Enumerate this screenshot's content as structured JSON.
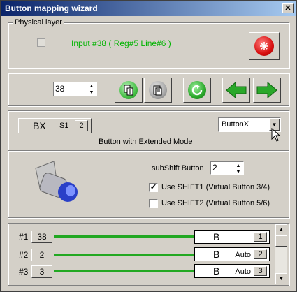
{
  "window": {
    "title": "Button mapping wizard",
    "close_symbol": "✕"
  },
  "physical": {
    "legend": "Physical layer",
    "input_text": "Input #38  ( Reg#5  Line#6 )"
  },
  "toolbar": {
    "index_value": "38"
  },
  "mapping": {
    "mode_main": "BX",
    "mode_shift": "S1",
    "mode_num": "2",
    "type_select": "ButtonX",
    "description": "Button  with Extended Mode"
  },
  "options": {
    "subshift_label": "subShift Button",
    "subshift_value": "2",
    "shift1_label": "Use SHIFT1 (Virtual Button 3/4)",
    "shift1_checked": true,
    "shift2_label": "Use SHIFT2 (Virtual Button 5/6)",
    "shift2_checked": false
  },
  "rows": [
    {
      "label": "#1",
      "button": "38",
      "letter": "B",
      "auto": "",
      "num": "1"
    },
    {
      "label": "#2",
      "button": "2",
      "letter": "B",
      "auto": "Auto",
      "num": "2"
    },
    {
      "label": "#3",
      "button": "3",
      "letter": "B",
      "auto": "Auto",
      "num": "3"
    }
  ],
  "colors": {
    "accent_green": "#22a822",
    "title_blue": "#0a246a",
    "input_text_green": "#00b400"
  }
}
